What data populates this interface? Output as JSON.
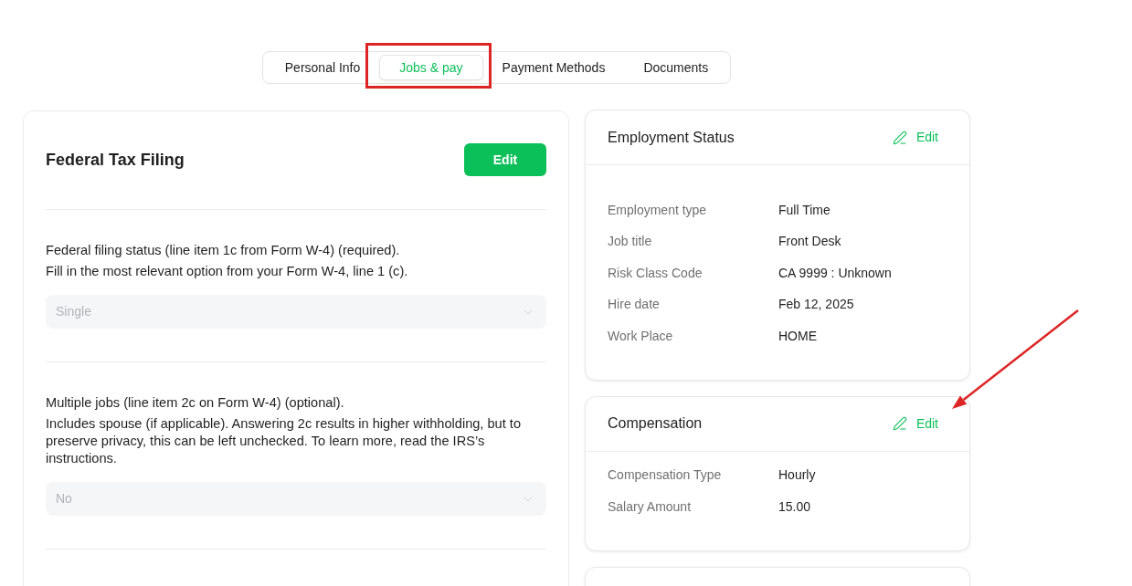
{
  "tabs": [
    {
      "label": "Personal Info",
      "selected": false,
      "highlighted": false
    },
    {
      "label": "Jobs & pay",
      "selected": true,
      "highlighted": true
    },
    {
      "label": "Payment Methods",
      "selected": false,
      "highlighted": false
    },
    {
      "label": "Documents",
      "selected": false,
      "highlighted": false
    }
  ],
  "federal_tax_filing": {
    "title": "Federal Tax Filing",
    "edit_button": "Edit",
    "fields": [
      {
        "label": "Federal filing status (line item 1c from Form W-4) (required).",
        "description": "Fill in the most relevant option from your Form W-4, line 1 (c).",
        "value": "Single",
        "disabled": true
      },
      {
        "label": "Multiple jobs (line item 2c on Form W-4) (optional).",
        "description": "Includes spouse (if applicable). Answering 2c results in higher withholding, but to preserve privacy, this can be left unchecked. To learn more, read the IRS’s instructions.",
        "value": "No",
        "disabled": true
      }
    ]
  },
  "cards": [
    {
      "title": "Employment Status",
      "edit_link": "Edit",
      "arrow_annotation": false,
      "rows": [
        {
          "label": "Employment type",
          "value": "Full Time"
        },
        {
          "label": "Job title",
          "value": "Front Desk"
        },
        {
          "label": "Risk Class Code",
          "value": "CA 9999 : Unknown"
        },
        {
          "label": "Hire date",
          "value": "Feb 12, 2025"
        },
        {
          "label": "Work Place",
          "value": "HOME"
        }
      ]
    },
    {
      "title": "Compensation",
      "edit_link": "Edit",
      "arrow_annotation": true,
      "rows": [
        {
          "label": "Compensation Type",
          "value": "Hourly"
        },
        {
          "label": "Salary Amount",
          "value": "15.00"
        }
      ]
    }
  ]
}
